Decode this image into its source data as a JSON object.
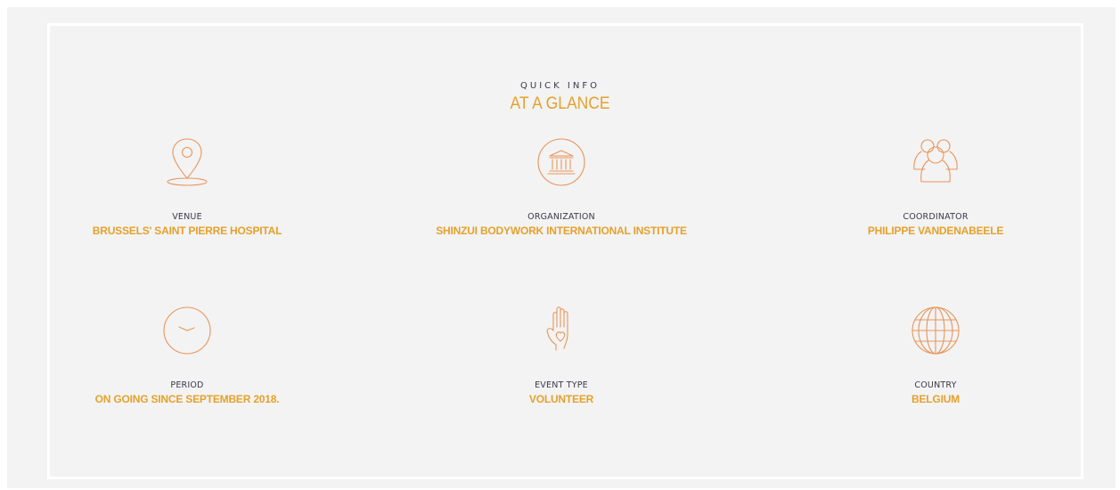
{
  "header": {
    "eyebrow": "QUICK INFO",
    "title": "AT A GLANCE"
  },
  "items": [
    {
      "icon": "map-pin-icon",
      "label": "VENUE",
      "value": "BRUSSELS' SAINT PIERRE HOSPITAL"
    },
    {
      "icon": "institution-icon",
      "label": "ORGANIZATION",
      "value": "SHINZUI BODYWORK INTERNATIONAL INSTITUTE"
    },
    {
      "icon": "people-icon",
      "label": "COORDINATOR",
      "value": "PHILIPPE VANDENABEELE"
    },
    {
      "icon": "clock-icon",
      "label": "PERIOD",
      "value": "ON GOING SINCE SEPTEMBER 2018."
    },
    {
      "icon": "hand-heart-icon",
      "label": "EVENT TYPE",
      "value": "VOLUNTEER"
    },
    {
      "icon": "globe-icon",
      "label": "COUNTRY",
      "value": "BELGIUM"
    }
  ],
  "colors": {
    "accent": "#e5a12b",
    "icon": "#e8955a",
    "text": "#3a3a4a",
    "panel": "#f3f3f3"
  }
}
